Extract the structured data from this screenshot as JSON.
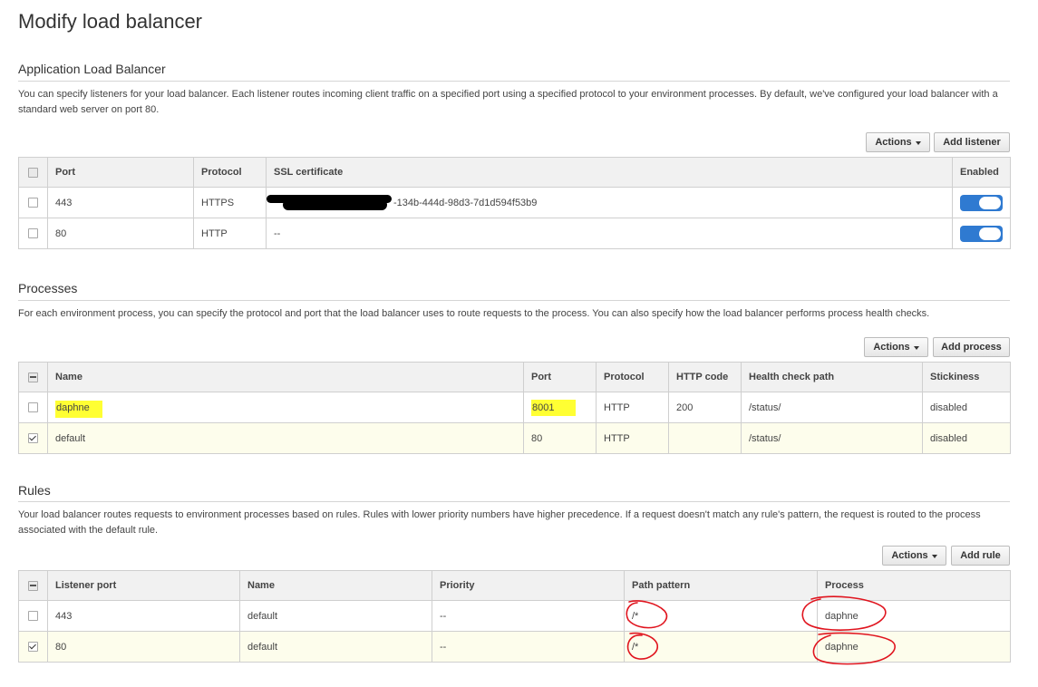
{
  "page": {
    "title": "Modify load balancer"
  },
  "alb": {
    "title": "Application Load Balancer",
    "description": "You can specify listeners for your load balancer. Each listener routes incoming client traffic on a specified port using a specified protocol to your environment processes. By default, we've configured your load balancer with a standard web server on port 80.",
    "actions_label": "Actions",
    "add_label": "Add listener",
    "columns": [
      "Port",
      "Protocol",
      "SSL certificate",
      "Enabled"
    ],
    "rows": [
      {
        "port": "443",
        "protocol": "HTTPS",
        "ssl": "-134b-444d-98d3-7d1d594f53b9",
        "enabled": true,
        "checked": false
      },
      {
        "port": "80",
        "protocol": "HTTP",
        "ssl": "--",
        "enabled": true,
        "checked": false
      }
    ]
  },
  "processes": {
    "title": "Processes",
    "description": "For each environment process, you can specify the protocol and port that the load balancer uses to route requests to the process. You can also specify how the load balancer performs process health checks.",
    "actions_label": "Actions",
    "add_label": "Add process",
    "columns": [
      "Name",
      "Port",
      "Protocol",
      "HTTP code",
      "Health check path",
      "Stickiness"
    ],
    "rows": [
      {
        "name": "daphne",
        "port": "8001",
        "protocol": "HTTP",
        "http_code": "200",
        "health_path": "/status/",
        "stickiness": "disabled",
        "checked": false
      },
      {
        "name": "default",
        "port": "80",
        "protocol": "HTTP",
        "http_code": "",
        "health_path": "/status/",
        "stickiness": "disabled",
        "checked": true
      }
    ]
  },
  "rules": {
    "title": "Rules",
    "description": "Your load balancer routes requests to environment processes based on rules. Rules with lower priority numbers have higher precedence. If a request doesn't match any rule's pattern, the request is routed to the process associated with the default rule.",
    "actions_label": "Actions",
    "add_label": "Add rule",
    "columns": [
      "Listener port",
      "Name",
      "Priority",
      "Path pattern",
      "Process"
    ],
    "rows": [
      {
        "listener_port": "443",
        "name": "default",
        "priority": "--",
        "path": "/*",
        "process": "daphne",
        "checked": false
      },
      {
        "listener_port": "80",
        "name": "default",
        "priority": "--",
        "path": "/*",
        "process": "daphne",
        "checked": true
      }
    ]
  },
  "colors": {
    "toggle_on": "#2f7ad1",
    "highlight": "#ffff33",
    "annotation": "#e0141e",
    "selected_row": "#fdfdec"
  }
}
